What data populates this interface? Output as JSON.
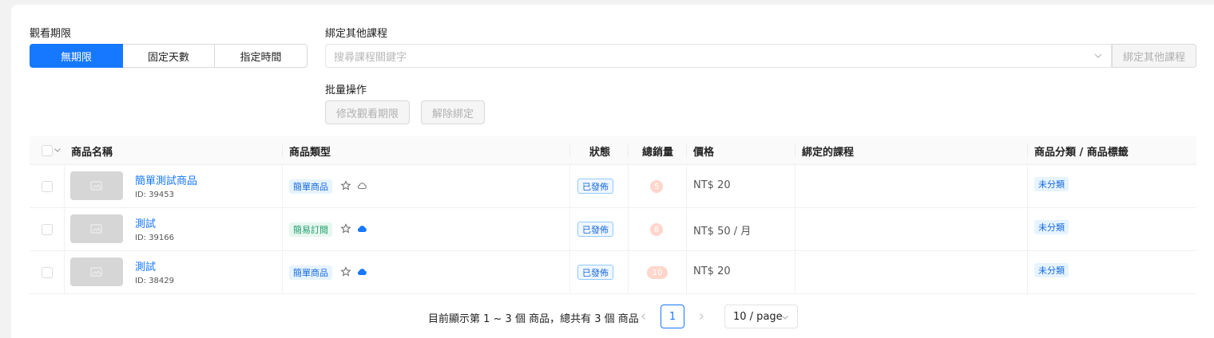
{
  "view_period": {
    "label": "觀看期限",
    "options": [
      "無期限",
      "固定天數",
      "指定時間"
    ],
    "selected": "無期限"
  },
  "bind_course": {
    "label": "綁定其他課程",
    "placeholder": "搜尋課程關鍵字",
    "button": "綁定其他課程"
  },
  "batch": {
    "label": "批量操作",
    "modify_button": "修改觀看期限",
    "unbind_button": "解除綁定"
  },
  "table": {
    "headers": {
      "name": "商品名稱",
      "type": "商品類型",
      "status": "狀態",
      "sales": "總銷量",
      "price": "價格",
      "bound": "綁定的課程",
      "category": "商品分類 / 商品標籤"
    },
    "rows": [
      {
        "name": "簡單測試商品",
        "id": "ID: 39453",
        "type": "簡單商品",
        "type_color": "blue",
        "cloud": "outline",
        "status": "已發佈",
        "sales": "5",
        "price": "NT$  20",
        "bound": "",
        "category": "未分類"
      },
      {
        "name": "測試",
        "id": "ID: 39166",
        "type": "簡易訂閱",
        "type_color": "green",
        "cloud": "filled",
        "status": "已發佈",
        "sales": "8",
        "price": "NT$  50 / 月",
        "bound": "",
        "category": "未分類"
      },
      {
        "name": "測試",
        "id": "ID: 38429",
        "type": "簡單商品",
        "type_color": "blue",
        "cloud": "filled",
        "status": "已發佈",
        "sales": "10",
        "price": "NT$  20",
        "bound": "",
        "category": "未分類"
      }
    ]
  },
  "pagination": {
    "summary": "目前顯示第 1 ~ 3 個 商品，總共有 3 個 商品",
    "current_page": "1",
    "page_size": "10 / page"
  },
  "colors": {
    "primary": "#1677ff",
    "sales_badge": "#ffd6cc",
    "tag_green": "#1f9e6f"
  }
}
